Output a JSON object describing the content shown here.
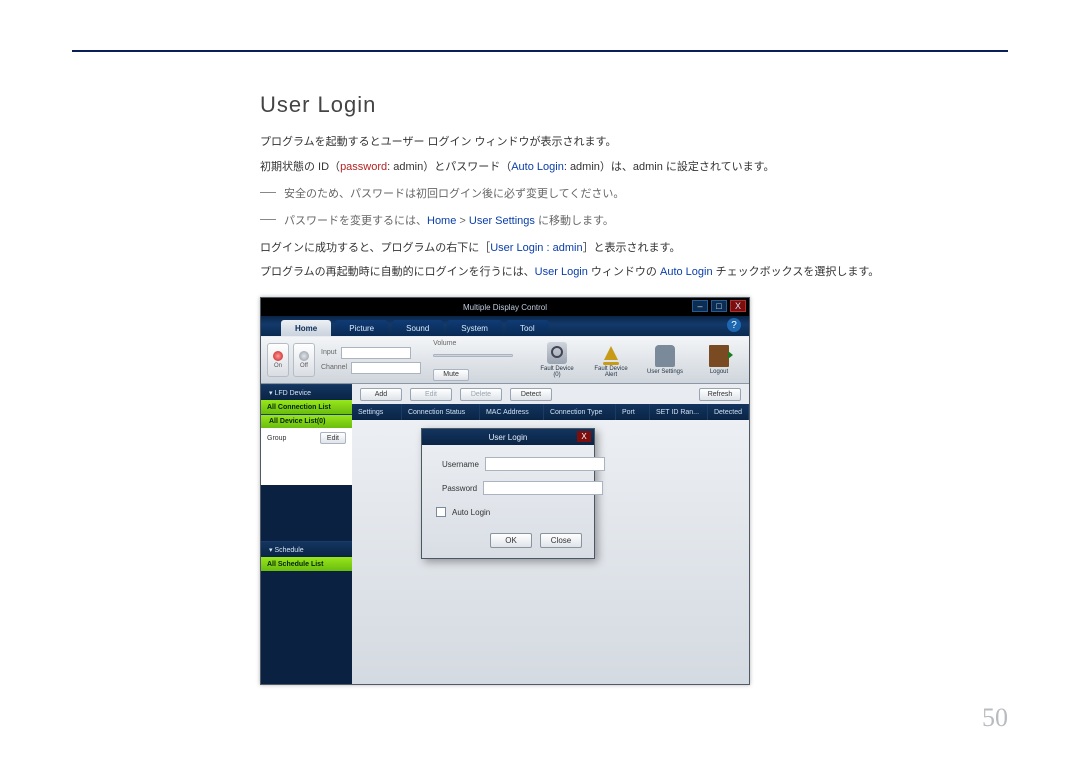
{
  "doc": {
    "title": "User Login",
    "p1_a": "プログラムを起動するとユーザー ログイン ウィンドウが表示されます。",
    "p2_a": "初期状態の ID（",
    "p2_kw1": "password",
    "p2_b": ": admin）とパスワード（",
    "p2_kw2": "Auto Login",
    "p2_c": ": admin）は、admin に設定されています。",
    "b1": "安全のため、パスワードは初回ログイン後に必ず変更してください。",
    "b2_a": "パスワードを変更するには、",
    "b2_kw1": "Home",
    "b2_sep": " > ",
    "b2_kw2": "User Settings",
    "b2_b": " に移動します。",
    "p3_a": "ログインに成功すると、プログラムの右下に［",
    "p3_kw": "User Login : admin",
    "p3_b": "］と表示されます。",
    "p4_a": "プログラムの再起動時に自動的にログインを行うには、",
    "p4_kw1": "User Login",
    "p4_b": " ウィンドウの ",
    "p4_kw2": "Auto Login",
    "p4_c": " チェックボックスを選択します。",
    "page_num": "50"
  },
  "app": {
    "title": "Multiple Display Control",
    "window": {
      "min": "–",
      "max": "□",
      "close": "X"
    },
    "tabs": [
      "Home",
      "Picture",
      "Sound",
      "System",
      "Tool"
    ],
    "help": "?",
    "toolbar": {
      "on": "On",
      "off": "Off",
      "input": "Input",
      "channel": "Channel",
      "volume": "Volume",
      "mute": "Mute",
      "fault_device": "Fault Device\n(0)",
      "fault_alert": "Fault Device\nAlert",
      "user_settings": "User Settings",
      "logout": "Logout"
    },
    "crud": {
      "add": "Add",
      "edit": "Edit",
      "delete": "Delete",
      "detect": "Detect",
      "refresh": "Refresh"
    },
    "columns": [
      "Settings",
      "Connection Status",
      "MAC Address",
      "Connection Type",
      "Port",
      "SET ID Ran...",
      "Detected"
    ],
    "sidebar": {
      "lfd": "▾ LFD Device",
      "all_conn": "All Connection List",
      "all_dev": "All Device List(0)",
      "group": "Group",
      "edit": "Edit",
      "schedule": "▾ Schedule",
      "all_sched": "All Schedule List"
    }
  },
  "dialog": {
    "title": "User Login",
    "username": "Username",
    "password": "Password",
    "auto": "Auto Login",
    "ok": "OK",
    "close": "Close"
  }
}
